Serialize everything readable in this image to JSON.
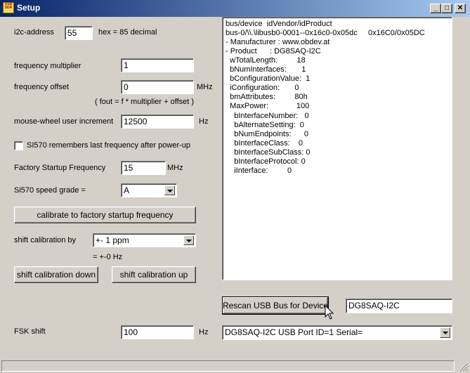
{
  "window": {
    "title": "Setup",
    "icon_text": "USB SDR",
    "minimize_glyph": "_",
    "maximize_glyph": "□",
    "close_glyph": "✕"
  },
  "i2c": {
    "label": "i2c-address",
    "value": "55",
    "hex_text": "hex =  85 decimal"
  },
  "freq_multiplier": {
    "label": "frequency multiplier",
    "value": "1"
  },
  "freq_offset": {
    "label": "frequency offset",
    "value": "0",
    "unit": "MHz",
    "formula": "( fout = f * multiplier + offset  )"
  },
  "mousewheel": {
    "label": "mouse-wheel user increment",
    "value": "12500",
    "unit": "Hz"
  },
  "remember_checkbox": {
    "label": "SI570 remembers last frequency after power-up",
    "checked": false
  },
  "factory_freq": {
    "label": "Factory Startup Frequency",
    "value": "15",
    "unit": "MHz"
  },
  "speed_grade": {
    "label": "Si570 speed grade =",
    "selected": "A"
  },
  "calibrate_button": "calibrate to factory startup frequency",
  "shift_cal": {
    "label": "shift calibration by",
    "selected": "+- 1 ppm",
    "result": "= +-0 Hz"
  },
  "shift_down_button": "shift calibration down",
  "shift_up_button": "shift calibration up",
  "fsk": {
    "label": "FSK shift",
    "value": "100",
    "unit": "Hz"
  },
  "usb_info_lines": [
    "bus/device  idVendor/idProduct",
    "bus-0/\\\\.\\libusb0-0001--0x16c0-0x05dc     0x16C0/0x05DC",
    "- Manufacturer : www.obdev.at",
    "- Product      : DG8SAQ-I2C",
    "  wTotalLength:         18",
    "  bNumInterfaces:       1",
    "  bConfigurationValue:  1",
    "  iConfiguration:       0",
    "  bmAttributes:         80h",
    "  MaxPower:             100",
    "    bInterfaceNumber:   0",
    "    bAlternateSetting:  0",
    "    bNumEndpoints:      0",
    "    bInterfaceClass:    0",
    "    bInterfaceSubClass: 0",
    "    bInterfaceProtocol: 0",
    "    iInterface:         0"
  ],
  "rescan_button": "Rescan USB Bus for Device",
  "device_name_field": "DG8SAQ-I2C",
  "device_select": "DG8SAQ-I2C    USB Port ID=1  Serial="
}
